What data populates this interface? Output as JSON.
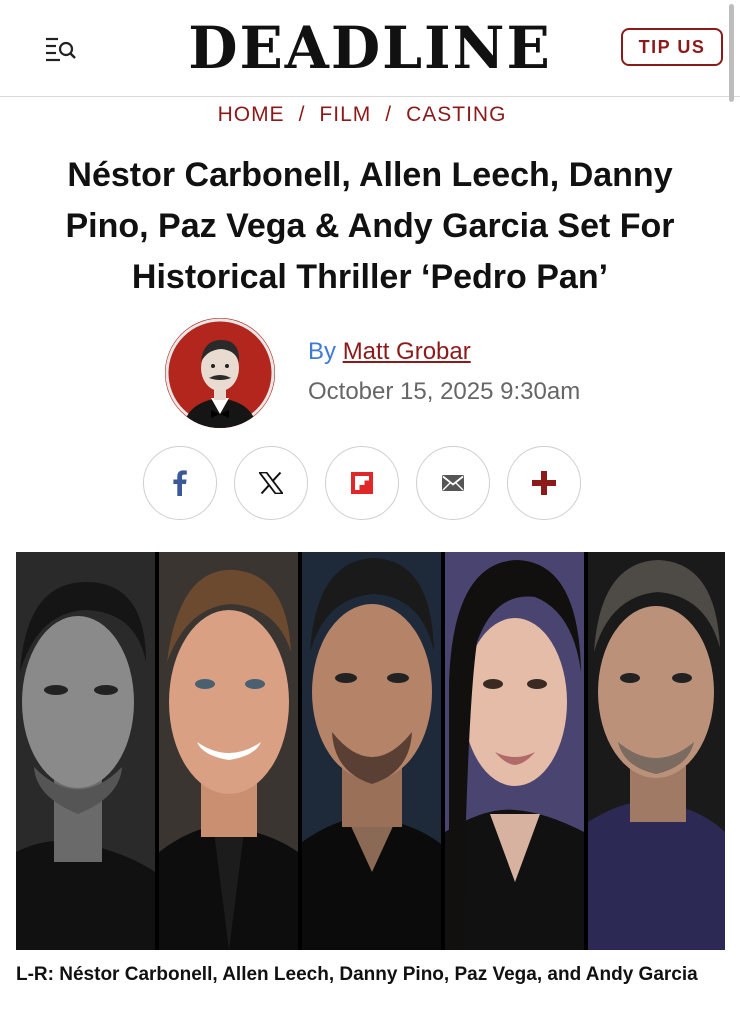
{
  "header": {
    "logo": "DEADLINE",
    "tip_label": "TIP US",
    "menu_icon": "menu-search-icon"
  },
  "breadcrumb": {
    "items": [
      "HOME",
      "FILM",
      "CASTING"
    ],
    "separator": "/"
  },
  "article": {
    "headline_lines": [
      "Néstor Carbonell, Allen Leech, Danny",
      "Pino, Paz Vega & Andy Garcia Set For",
      "Historical Thriller ‘Pedro Pan’"
    ],
    "byline_prefix": "By",
    "author": "Matt Grobar",
    "date": "October 15, 2025 9:30am",
    "caption": "L-R: Néstor Carbonell, Allen Leech, Danny Pino, Paz Vega, and Andy Garcia"
  },
  "share": {
    "buttons": [
      "facebook-icon",
      "x-icon",
      "flipboard-icon",
      "email-icon",
      "more-plus-icon"
    ]
  },
  "colors": {
    "brand": "#8b1a1a",
    "byline_blue": "#3f7ad6",
    "facebook": "#3b5998",
    "flipboard": "#e12828"
  }
}
